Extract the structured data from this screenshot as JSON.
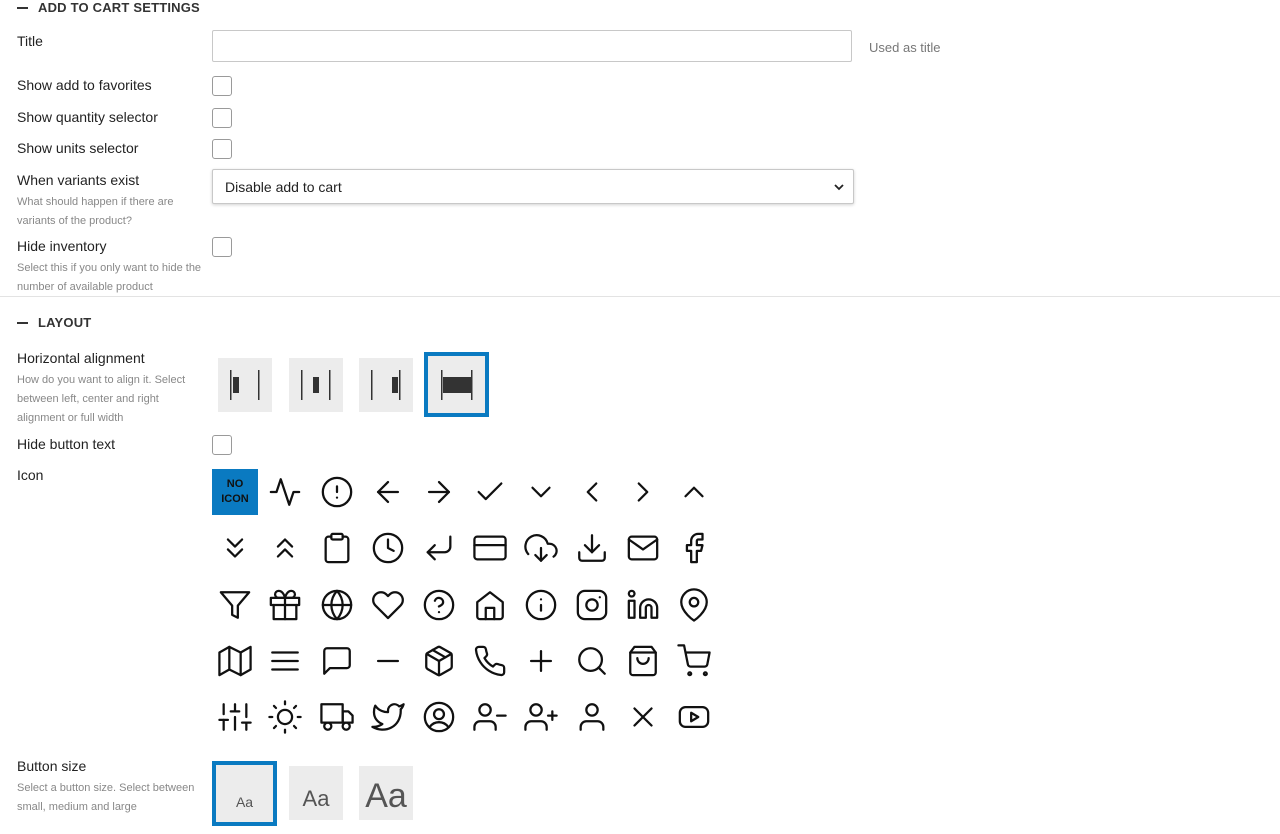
{
  "cart_section": {
    "title": "ADD TO CART SETTINGS",
    "title_label": "Title",
    "title_value": "",
    "title_aside": "Used as title",
    "favorites_label": "Show add to favorites",
    "quantity_label": "Show quantity selector",
    "units_label": "Show units selector",
    "variants_label": "When variants exist",
    "variants_hint": "What should happen if there are variants of the product?",
    "variants_value": "Disable add to cart",
    "inventory_label": "Hide inventory",
    "inventory_hint": "Select this if you only want to hide the number of available product"
  },
  "layout_section": {
    "title": "LAYOUT",
    "align_label": "Horizontal alignment",
    "align_hint": "How do you want to align it. Select between left, center and right alignment or full width",
    "align_options": [
      "left",
      "center",
      "right",
      "full-width"
    ],
    "align_selected": "full-width",
    "hide_text_label": "Hide button text",
    "icon_label": "Icon",
    "no_icon_line1": "NO",
    "no_icon_line2": "ICON",
    "icons": [
      "activity-icon",
      "alert-circle-icon",
      "arrow-left-icon",
      "arrow-right-icon",
      "check-icon",
      "chevron-down-icon",
      "chevron-left-icon",
      "chevron-right-icon",
      "chevron-up-icon",
      "chevrons-down-icon",
      "chevrons-up-icon",
      "clipboard-icon",
      "clock-icon",
      "corner-down-left-icon",
      "credit-card-icon",
      "download-cloud-icon",
      "download-icon",
      "mail-icon",
      "facebook-icon",
      "filter-icon",
      "gift-icon",
      "globe-icon",
      "heart-icon",
      "help-circle-icon",
      "home-icon",
      "info-icon",
      "instagram-icon",
      "linkedin-icon",
      "map-pin-icon",
      "map-icon",
      "menu-icon",
      "message-square-icon",
      "minus-icon",
      "package-icon",
      "phone-icon",
      "plus-icon",
      "search-icon",
      "shopping-bag-icon",
      "shopping-cart-icon",
      "sliders-icon",
      "sun-icon",
      "truck-icon",
      "twitter-icon",
      "user-circle-icon",
      "user-minus-icon",
      "user-plus-icon",
      "user-icon",
      "x-icon",
      "youtube-icon"
    ],
    "size_label": "Button size",
    "size_hint": "Select a button size. Select between small, medium and large",
    "size_sample": "Aa",
    "size_selected": "small"
  },
  "colors": {
    "accent": "#0a7ac1"
  }
}
